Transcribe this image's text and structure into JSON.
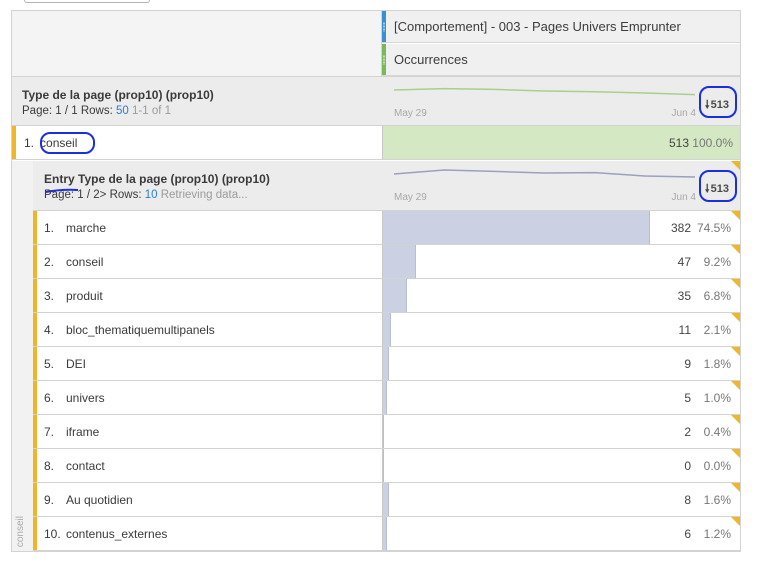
{
  "metric_header": {
    "segment": "[Comportement] - 003 - Pages Univers Emprunter",
    "metric": "Occurrences"
  },
  "colors": {
    "segment_stripe": "#3a8fd1",
    "metric_stripe": "#7ab85b",
    "accent": "#f0b62b",
    "top_bar": "#d3e8c3",
    "bar": "#cbd0e3",
    "annotation": "#1a2fe0"
  },
  "dimension": {
    "title": "Type de la page (prop10) (prop10)",
    "page_label": "Page:",
    "page_value": "1 / 1",
    "rows_label": "Rows:",
    "rows_value": "50",
    "range": "1-1 of 1",
    "date_start": "May 29",
    "date_end": "Jun 4",
    "total": "513",
    "sparkline": [
      0.55,
      0.62,
      0.58,
      0.5,
      0.46,
      0.4,
      0.32
    ]
  },
  "top_row": {
    "num": "1.",
    "name": "conseil",
    "value": "513",
    "pct": "100.0%",
    "fraction": 1.0
  },
  "breakdown": {
    "side_label": "conseil",
    "title": "Entry Type de la page (prop10) (prop10)",
    "page_label": "Page:",
    "page_value": "1 / 2",
    "next_icon": ">",
    "rows_label": "Rows:",
    "rows_value": "10",
    "status": "Retrieving data...",
    "date_start": "May 29",
    "date_end": "Jun 4",
    "total": "513",
    "sparkline": [
      0.55,
      0.75,
      0.68,
      0.6,
      0.62,
      0.45,
      0.4
    ],
    "rows": [
      {
        "num": "1.",
        "name": "marche",
        "value": "382",
        "pct": "74.5%",
        "fraction": 0.745
      },
      {
        "num": "2.",
        "name": "conseil",
        "value": "47",
        "pct": "9.2%",
        "fraction": 0.092
      },
      {
        "num": "3.",
        "name": "produit",
        "value": "35",
        "pct": "6.8%",
        "fraction": 0.068
      },
      {
        "num": "4.",
        "name": "bloc_thematiquemultipanels",
        "value": "11",
        "pct": "2.1%",
        "fraction": 0.021
      },
      {
        "num": "5.",
        "name": "DEI",
        "value": "9",
        "pct": "1.8%",
        "fraction": 0.018
      },
      {
        "num": "6.",
        "name": "univers",
        "value": "5",
        "pct": "1.0%",
        "fraction": 0.01
      },
      {
        "num": "7.",
        "name": "iframe",
        "value": "2",
        "pct": "0.4%",
        "fraction": 0.004
      },
      {
        "num": "8.",
        "name": "contact",
        "value": "0",
        "pct": "0.0%",
        "fraction": 0.0
      },
      {
        "num": "9.",
        "name": "Au quotidien",
        "value": "8",
        "pct": "1.6%",
        "fraction": 0.016
      },
      {
        "num": "10.",
        "name": "contenus_externes",
        "value": "6",
        "pct": "1.2%",
        "fraction": 0.012
      }
    ]
  }
}
